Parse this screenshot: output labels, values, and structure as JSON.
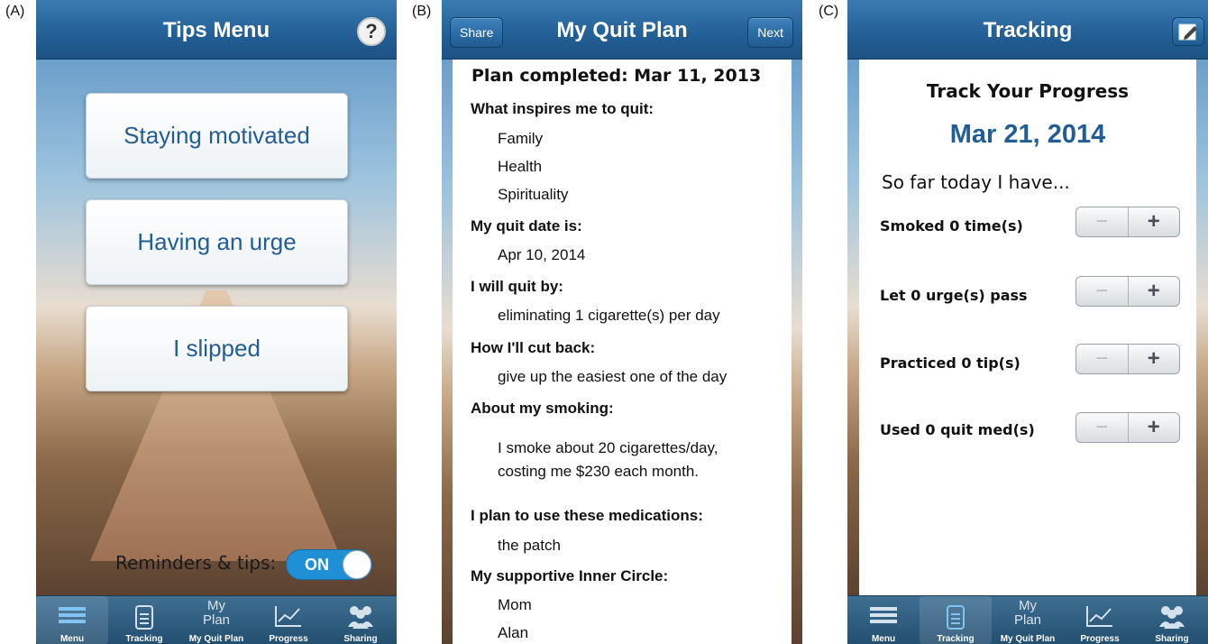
{
  "panels": {
    "a": "(A)",
    "b": "(B)",
    "c": "(C)"
  },
  "tips": {
    "title": "Tips Menu",
    "help_icon": "question-icon",
    "cards": [
      "Staying motivated",
      "Having an urge",
      "I slipped"
    ],
    "reminders_label": "Reminders & tips:",
    "reminders_state": "ON"
  },
  "tabs": {
    "menu": "Menu",
    "tracking": "Tracking",
    "myplan_icon_text": [
      "My",
      "Plan"
    ],
    "myquitplan": "My Quit Plan",
    "progress": "Progress",
    "sharing": "Sharing"
  },
  "plan": {
    "title": "My Quit Plan",
    "share_label": "Share",
    "next_label": "Next",
    "completed": "Plan completed: Mar 11, 2013",
    "inspires_heading": "What inspires me to quit:",
    "inspires": [
      "Family",
      "Health",
      "Spirituality"
    ],
    "quit_date_heading": "My quit date is:",
    "quit_date": "Apr 10, 2014",
    "quit_by_heading": "I will quit by:",
    "quit_by": "eliminating 1 cigarette(s) per day",
    "cut_back_heading": "How I'll cut back:",
    "cut_back": "give up the easiest one of the day",
    "about_heading": "About my smoking:",
    "about_line1": "I smoke about 20 cigarettes/day,",
    "about_line2": "costing me $230 each month.",
    "meds_heading": "I plan to use these medications:",
    "meds": "the patch",
    "circle_heading": "My supportive Inner Circle:",
    "circle": [
      "Mom",
      "Alan"
    ]
  },
  "tracking": {
    "title": "Tracking",
    "edit_icon": "edit-icon",
    "heading": "Track Your Progress",
    "date": "Mar 21, 2014",
    "intro": "So far today I have...",
    "rows": [
      "Smoked 0 time(s)",
      "Let 0 urge(s) pass",
      "Practiced 0 tip(s)",
      "Used 0 quit med(s)"
    ],
    "minus": "−",
    "plus": "+"
  },
  "colors": {
    "nav_blue": "#225f95",
    "accent_text": "#235d95",
    "toggle_on": "#1f8fd6"
  }
}
